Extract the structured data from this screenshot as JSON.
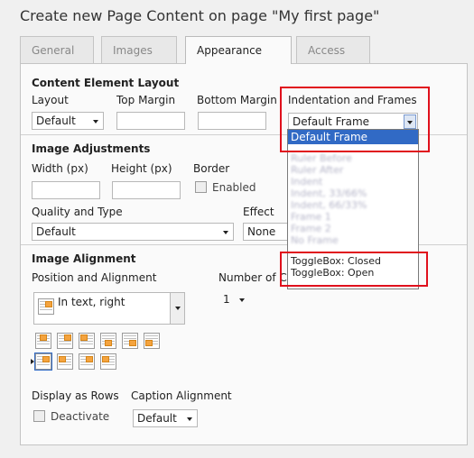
{
  "page_title": "Create new Page Content on page \"My first page\"",
  "tabs": [
    {
      "label": "General"
    },
    {
      "label": "Images"
    },
    {
      "label": "Appearance"
    },
    {
      "label": "Access"
    }
  ],
  "active_tab": "Appearance",
  "content_layout": {
    "title": "Content Element Layout",
    "layout_label": "Layout",
    "layout_value": "Default",
    "top_margin_label": "Top Margin",
    "bottom_margin_label": "Bottom Margin",
    "frames_label": "Indentation and Frames",
    "frames_value": "Default Frame"
  },
  "frames_dropdown": {
    "selected": "Default Frame",
    "options": [
      "Default Frame",
      "Ruler Before",
      "Ruler After",
      "Indent",
      "Indent, 33/66%",
      "Indent, 66/33%",
      "Frame 1",
      "Frame 2",
      "No Frame",
      "ToggleBox: Closed",
      "ToggleBox: Open"
    ]
  },
  "image_adjustments": {
    "title": "Image Adjustments",
    "width_label": "Width (px)",
    "height_label": "Height (px)",
    "border_label": "Border",
    "border_checkbox_label": "Enabled",
    "quality_label": "Quality and Type",
    "quality_value": "Default",
    "effect_label": "Effect",
    "effect_value": "None"
  },
  "image_alignment": {
    "title": "Image Alignment",
    "position_label": "Position and Alignment",
    "position_value": "In text, right",
    "columns_label": "Number of Columns",
    "columns_value": "1",
    "rows_label": "Display as Rows",
    "rows_checkbox_label": "Deactivate",
    "caption_label": "Caption Alignment",
    "caption_value": "Default"
  },
  "colors": {
    "selection": "#316ac5",
    "highlight": "#e0101c",
    "image_icon": "#f4a33e"
  }
}
